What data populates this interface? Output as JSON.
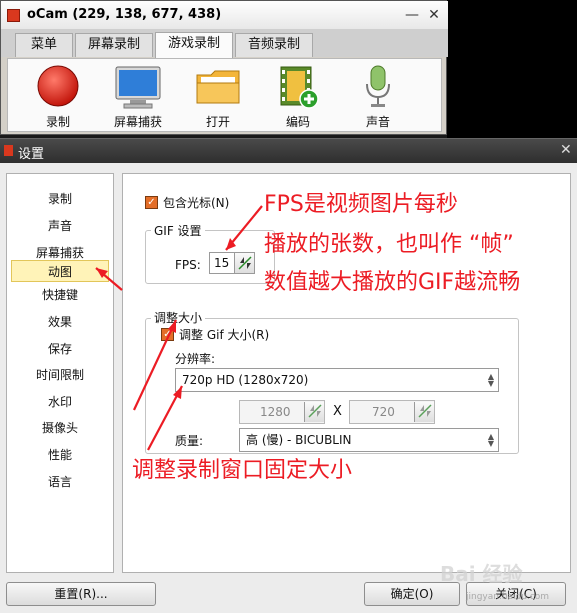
{
  "app": {
    "title": "oCam (229, 138, 677, 438)",
    "minimize_glyph": "—",
    "close_glyph": "✕"
  },
  "tabs": [
    {
      "label": "菜单",
      "active": false
    },
    {
      "label": "屏幕录制",
      "active": false
    },
    {
      "label": "游戏录制",
      "active": true
    },
    {
      "label": "音频录制",
      "active": false
    }
  ],
  "toolbar": {
    "items": [
      {
        "label": "录制",
        "icon": "record-icon"
      },
      {
        "label": "屏幕捕获",
        "icon": "monitor-icon"
      },
      {
        "label": "打开",
        "icon": "folder-icon"
      },
      {
        "label": "编码",
        "icon": "film-add-icon"
      },
      {
        "label": "声音",
        "icon": "microphone-icon"
      }
    ]
  },
  "dialog": {
    "title": "设置",
    "close_glyph": "✕",
    "sidebar": [
      {
        "label": "录制",
        "active": false
      },
      {
        "label": "声音",
        "active": false
      },
      {
        "label": "屏幕捕获",
        "active": false
      },
      {
        "label": "动图",
        "active": true
      },
      {
        "label": "快捷键",
        "active": false
      },
      {
        "label": "效果",
        "active": false
      },
      {
        "label": "保存",
        "active": false
      },
      {
        "label": "时间限制",
        "active": false
      },
      {
        "label": "水印",
        "active": false
      },
      {
        "label": "摄像头",
        "active": false
      },
      {
        "label": "性能",
        "active": false
      },
      {
        "label": "语言",
        "active": false
      }
    ],
    "panel": {
      "include_cursor_label": "包含光标(N)",
      "include_cursor_checked": true,
      "gif_group_title": "GIF 设置",
      "fps_label": "FPS:",
      "fps_value": "15",
      "size_group_title": "调整大小",
      "resize_label": "调整 Gif 大小(R)",
      "resize_checked": true,
      "resolution_label": "分辨率:",
      "resolution_value": "720p HD (1280x720)",
      "width_value": "1280",
      "times_glyph": "X",
      "height_value": "720",
      "quality_label": "质量:",
      "quality_value": "高 (慢) - BICUBLIN"
    },
    "buttons": {
      "reset": "重置(R)...",
      "ok": "确定(O)",
      "close": "关闭(C)"
    }
  },
  "annotations": {
    "line1": "FPS是视频图片每秒",
    "line2": "播放的张数，也叫作 “帧”",
    "line3": "数值越大播放的GIF越流畅",
    "resize_note": "调整录制窗口固定大小",
    "color": "#ec1c24"
  },
  "watermark": {
    "text": "Bai 经验",
    "url": "jingyan.baidu.com"
  },
  "colors": {
    "checkbox": "#e46e28",
    "selected_item": "#fff3b8"
  }
}
